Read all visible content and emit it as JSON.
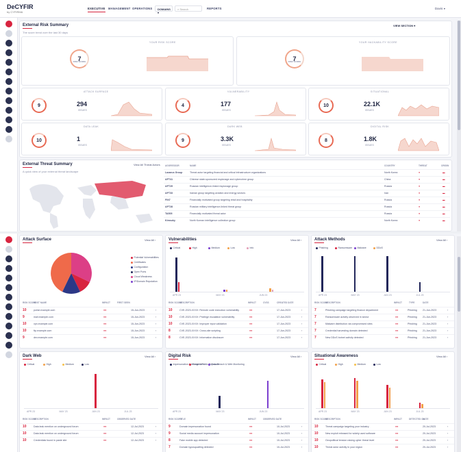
{
  "app": {
    "logo": "DeCYFIR",
    "logo_sub": "by CYFIRMA"
  },
  "nav": {
    "executive": "EXECUTIVE",
    "management": "MANAGEMENT",
    "operations": "OPERATIONS",
    "domains": "DOMAINS",
    "search_placeholder": "Search",
    "reports": "REPORTS",
    "user": "Davis"
  },
  "ers": {
    "title": "External Risk Summary",
    "subtitle": "The score trend over the last 30 days",
    "view_section": "VIEW SECTION",
    "risk_label": "YOUR RISK SCORE",
    "risk_score": "7",
    "hack_label": "YOUR HACKABILITY SCORE",
    "hack_score": "7",
    "ring_sub": "RISK SCORE",
    "tiles": [
      {
        "label": "ATTACK SURFACE",
        "score": "9",
        "count": "294",
        "count_label": "ISSUES"
      },
      {
        "label": "VULNERABILITY",
        "score": "4",
        "count": "177",
        "count_label": "ISSUES"
      },
      {
        "label": "SITUATIONAL",
        "score": "10",
        "count": "22.1K",
        "count_label": "ISSUES"
      },
      {
        "label": "DATA LEAK",
        "score": "10",
        "count": "1",
        "count_label": "ISSUES"
      },
      {
        "label": "DARK WEB",
        "score": "9",
        "count": "3.3K",
        "count_label": "ISSUES"
      },
      {
        "label": "DIGITAL RISK",
        "score": "8",
        "count": "1.8K",
        "count_label": "ISSUES"
      }
    ]
  },
  "ets": {
    "title": "External Threat Summary",
    "subtitle": "A quick view of your external threat landscape",
    "view_all": "View All Threat Actors",
    "columns": [
      "AGGRESSOR",
      "NAME",
      "COUNTRY",
      "THREAT",
      "ORIGIN"
    ],
    "rows": [
      [
        "Lazarus Group",
        "Threat actor targeting financial and critical infrastructure organizations",
        "North Korea"
      ],
      [
        "APT41",
        "Chinese state-sponsored espionage and cybercrime group",
        "China"
      ],
      [
        "APT29",
        "Russian intelligence-linked espionage group",
        "Russia"
      ],
      [
        "APT33",
        "Iranian group targeting aviation and energy sectors",
        "Iran"
      ],
      [
        "FIN7",
        "Financially motivated group targeting retail and hospitality",
        "Russia"
      ],
      [
        "APT28",
        "Russian military intelligence-linked threat group",
        "Russia"
      ],
      [
        "TA505",
        "Financially motivated threat actor",
        "Russia"
      ],
      [
        "Kimsuky",
        "North Korean intelligence collection group",
        "North Korea"
      ]
    ]
  },
  "attack_surface": {
    "title": "Attack Surface",
    "view_all": "View All",
    "legend": [
      "Potential Vulnerabilities",
      "Certificates",
      "Configuration",
      "Open Ports",
      "Cloud Weakness",
      "IP/Domain Reputation"
    ],
    "columns": [
      "RISK SCORE",
      "HOST NAME",
      "IMPACT",
      "FIRST SEEN"
    ],
    "rows": [
      [
        "10",
        "portal.example.com",
        "15-Jun-2023"
      ],
      [
        "9",
        "mail.example.com",
        "15-Jun-2023"
      ],
      [
        "10",
        "vpn.example.com",
        "15-Jun-2023"
      ],
      [
        "10",
        "ftp.example.com",
        "15-Jun-2023"
      ],
      [
        "9",
        "dev.example.com",
        "15-Jun-2023"
      ]
    ]
  },
  "vulnerabilities": {
    "title": "Vulnerabilities",
    "view_all": "View All",
    "legend": [
      "Critical",
      "High",
      "Medium",
      "Low",
      "Info"
    ],
    "xlabels": [
      "APR 23",
      "MAY 23",
      "JUN 23"
    ],
    "columns": [
      "RISK SCORE",
      "DESCRIPTION",
      "IMPACT",
      "CVSS",
      "CREATED DATE"
    ],
    "rows": [
      [
        "10",
        "CVE-2023-XXXX: Remote code execution vulnerability",
        "17-Jun-2023"
      ],
      [
        "10",
        "CVE-2023-XXXX: Privilege escalation vulnerability",
        "17-Jun-2023"
      ],
      [
        "10",
        "CVE-2023-XXXX: Improper input validation",
        "17-Jun-2023"
      ],
      [
        "8",
        "CVE-2023-XXXX: Cross-site scripting",
        "17-Jun-2023"
      ],
      [
        "8",
        "CVE-2023-XXXX: Information disclosure",
        "17-Jun-2023"
      ]
    ]
  },
  "attack_methods": {
    "title": "Attack Methods",
    "view_all": "View All",
    "legend": [
      "Phishing",
      "Ransomware",
      "Malware",
      "DDoS"
    ],
    "xlabels": [
      "APR 23",
      "MAY 23",
      "JUN 23",
      "JUL 23"
    ],
    "columns": [
      "RISK SCORE",
      "DESCRIPTION",
      "IMPACT",
      "TYPE",
      "DATE"
    ],
    "rows": [
      [
        "7",
        "Phishing campaign targeting finance department",
        "Phishing",
        "21-Jun-2023"
      ],
      [
        "7",
        "Ransomware activity observed in sector",
        "Phishing",
        "21-Jun-2023"
      ],
      [
        "7",
        "Malware distribution via compromised sites",
        "Phishing",
        "21-Jun-2023"
      ],
      [
        "7",
        "Credential harvesting domain detected",
        "Phishing",
        "21-Jun-2023"
      ],
      [
        "7",
        "New DDoS botnet activity detected",
        "Phishing",
        "21-Jun-2023"
      ]
    ]
  },
  "dark_web": {
    "title": "Dark Web",
    "view_all": "View All",
    "legend": [
      "Critical",
      "High",
      "Medium",
      "Low"
    ],
    "xlabels": [
      "APR 23",
      "MAY 23",
      "JUN 23",
      "JUL 23"
    ],
    "columns": [
      "RISK SCORE",
      "DESCRIPTION",
      "IMPACT",
      "OBSERVED DATE"
    ],
    "rows": [
      [
        "10",
        "Data leak mention on underground forum",
        "12-Jul-2023"
      ],
      [
        "10",
        "Data leak mention on underground forum",
        "12-Jul-2023"
      ],
      [
        "10",
        "Credentials found in paste site",
        "12-Jul-2023"
      ]
    ]
  },
  "digital_risk": {
    "title": "Digital Risk",
    "view_all": "View All",
    "legend": [
      "Impersonation & Infringement",
      "Social & Public Exposure",
      "Data Breach & Web Monitoring"
    ],
    "xlabels": [
      "APR 23",
      "MAY 23",
      "JUN 23"
    ],
    "columns": [
      "RISK SCORE",
      "TITLE",
      "IMPACT",
      "OBSERVED DATE"
    ],
    "rows": [
      [
        "9",
        "Domain impersonation found",
        "10-Jul-2023"
      ],
      [
        "9",
        "Social media account impersonation",
        "10-Jul-2023"
      ],
      [
        "8",
        "Fake mobile app detected",
        "10-Jul-2023"
      ],
      [
        "7",
        "Domain typosquatting detected",
        "10-Jul-2023"
      ]
    ]
  },
  "situational": {
    "title": "Situational Awareness",
    "view_all": "View All",
    "legend": [
      "Critical",
      "High",
      "Medium",
      "Low"
    ],
    "xlabels": [
      "APR 23",
      "MAY 23",
      "JUN 23",
      "JUL 23"
    ],
    "columns": [
      "RISK SCORE",
      "DESCRIPTION",
      "IMPACT",
      "DETECTED ON",
      "DATE"
    ],
    "rows": [
      [
        "10",
        "Threat campaign targeting your industry",
        "20-Jul-2023"
      ],
      [
        "10",
        "New exploit released for widely used software",
        "20-Jul-2023"
      ],
      [
        "10",
        "Geopolitical tension raising cyber threat level",
        "20-Jul-2023"
      ],
      [
        "10",
        "Threat actor activity in your region",
        "20-Jul-2023"
      ]
    ]
  },
  "colors": {
    "brand_red": "#d8243f",
    "navy": "#22275a",
    "pie_pink": "#dc3f86",
    "pie_orange": "#ef6a4a",
    "pie_navy": "#2c3886",
    "purple": "#7b3fcf",
    "orange": "#f2a14a"
  }
}
